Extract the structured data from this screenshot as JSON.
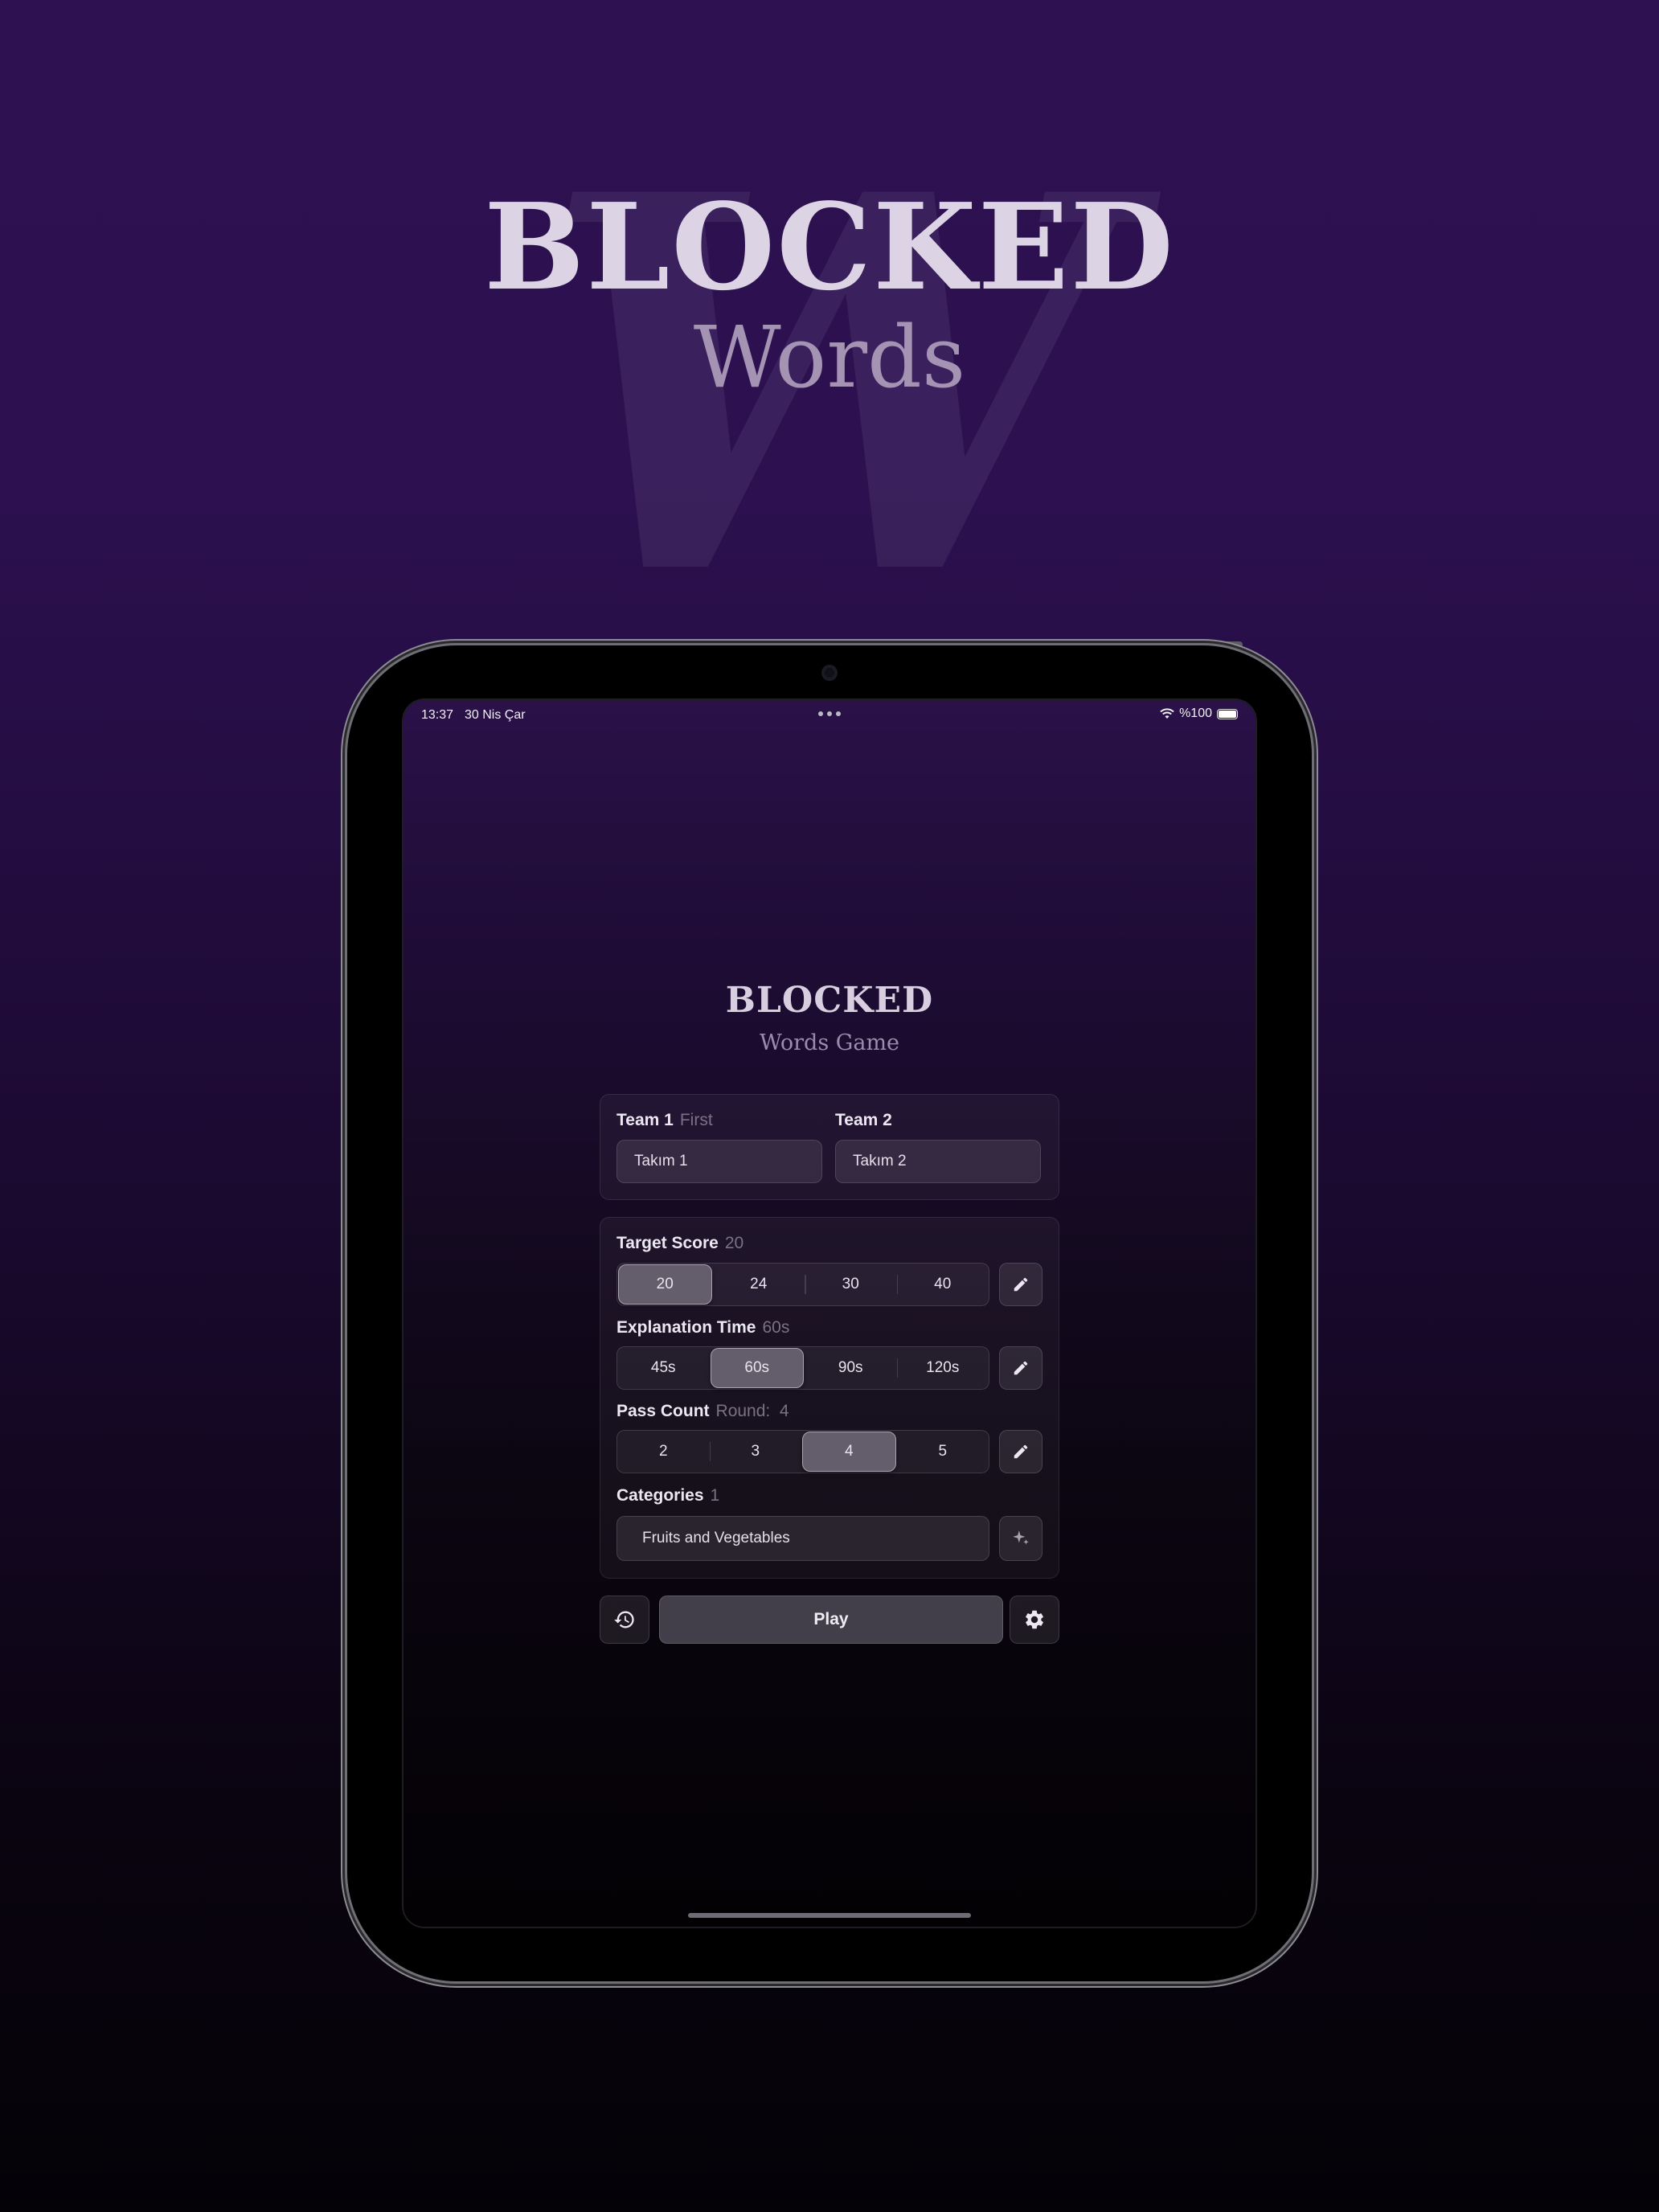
{
  "marketing": {
    "watermark_letter": "W",
    "title": "BLOCKED",
    "subtitle": "Words"
  },
  "status_bar": {
    "time": "13:37",
    "date": "30 Nis Çar",
    "battery_text": "%100",
    "icons": [
      "wifi-icon",
      "battery-icon"
    ]
  },
  "app": {
    "title": "BLOCKED",
    "subtitle": "Words Game"
  },
  "teams": {
    "team1_label": "Team 1",
    "team1_hint": "First",
    "team1_value": "Takım 1",
    "team2_label": "Team 2",
    "team2_value": "Takım 2"
  },
  "settings": {
    "target_score": {
      "label": "Target Score",
      "value": "20",
      "options": [
        "20",
        "24",
        "30",
        "40"
      ],
      "selected": "20"
    },
    "explanation_time": {
      "label": "Explanation Time",
      "value": "60s",
      "options": [
        "45s",
        "60s",
        "90s",
        "120s"
      ],
      "selected": "60s"
    },
    "pass_count": {
      "label": "Pass Count",
      "value": "Round:  4",
      "options": [
        "2",
        "3",
        "4",
        "5"
      ],
      "selected": "4"
    },
    "categories": {
      "label": "Categories",
      "value": "1",
      "selected_text": "Fruits and Vegetables"
    }
  },
  "actions": {
    "play_label": "Play",
    "history_icon": "history-icon",
    "settings_icon": "gear-icon",
    "edit_icon": "pencil-icon",
    "categories_icon": "sparkle-icon"
  },
  "colors": {
    "background_top": "#2d1150",
    "background_bottom": "#040207",
    "selected_segment": "#645d6c",
    "play_button": "#433f4a"
  }
}
